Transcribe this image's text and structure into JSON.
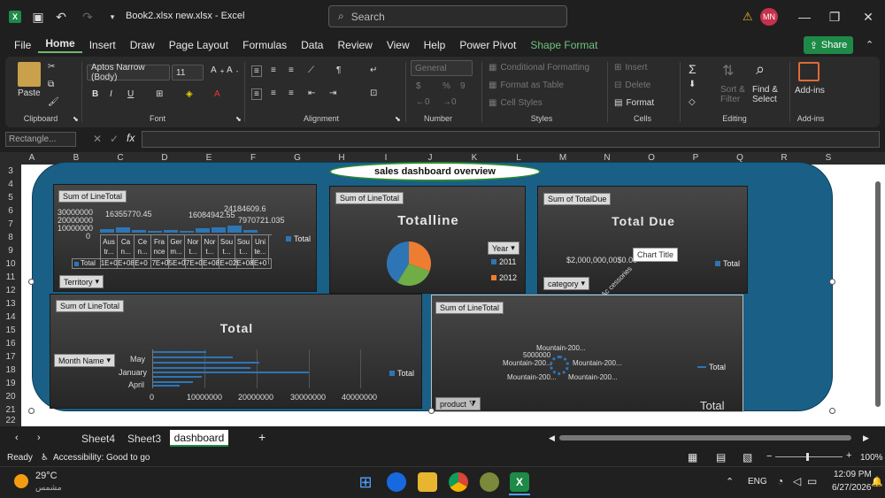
{
  "window": {
    "title": "Book2.xlsx new.xlsx  -  Excel",
    "search_placeholder": "Search",
    "avatar": "MN"
  },
  "menu": [
    "File",
    "Home",
    "Insert",
    "Draw",
    "Page Layout",
    "Formulas",
    "Data",
    "Review",
    "View",
    "Help",
    "Power Pivot",
    "Shape Format"
  ],
  "share_label": "Share",
  "ribbon": {
    "clipboard": {
      "paste": "Paste",
      "label": "Clipboard"
    },
    "font": {
      "name": "Aptos Narrow (Body)",
      "size": "11",
      "label": "Font"
    },
    "alignment": {
      "label": "Alignment"
    },
    "number": {
      "format": "General",
      "label": "Number"
    },
    "styles": {
      "conditional": "Conditional Formatting",
      "table": "Format as Table",
      "cell": "Cell Styles",
      "label": "Styles"
    },
    "cells": {
      "insert": "Insert",
      "delete": "Delete",
      "format": "Format",
      "label": "Cells"
    },
    "editing": {
      "sort": "Sort & Filter",
      "find": "Find & Select",
      "label": "Editing"
    },
    "addins": {
      "btn": "Add-ins",
      "label": "Add-ins"
    }
  },
  "namebox": "Rectangle...",
  "columns": [
    "A",
    "B",
    "C",
    "D",
    "E",
    "F",
    "G",
    "H",
    "I",
    "J",
    "K",
    "L",
    "M",
    "N",
    "O",
    "P",
    "Q",
    "R",
    "S"
  ],
  "rows": [
    "3",
    "4",
    "5",
    "6",
    "7",
    "8",
    "9",
    "10",
    "11",
    "12",
    "13",
    "14",
    "15",
    "16",
    "17",
    "18",
    "19",
    "20",
    "21",
    "22"
  ],
  "dashboard": {
    "banner": "sales dashboard overview",
    "territory": {
      "field": "Sum of LineTotal",
      "filter": "Territory",
      "legend": "Total",
      "y_ticks": [
        "30000000",
        "20000000",
        "10000000",
        "0"
      ],
      "labels": [
        "16355770.45",
        "24184609.6",
        "16084942.55",
        "7970721.035"
      ],
      "categories": [
        "Aus tr...",
        "Ca n...",
        "Ce n...",
        "Fra nce",
        "Ger m...",
        "Nor t...",
        "Nor t...",
        "Sou t...",
        "Sou t...",
        "Uni te..."
      ],
      "table_label": "Total",
      "table_values": [
        "1E+02",
        "E+08",
        "E+0",
        "7E+0",
        "5E+0",
        "7E+02",
        "E+08",
        "E+02",
        "E+08",
        "E+0"
      ]
    },
    "pie": {
      "field": "Sum of LineTotal",
      "title": "Totalline",
      "filter": "Year",
      "legend": [
        "2011",
        "2012"
      ],
      "colors": [
        "#2e75b6",
        "#ed7d31",
        "#70ad47"
      ]
    },
    "due": {
      "field": "Sum of TotalDue",
      "title": "Total Due",
      "filter": "category",
      "value": "$2,000,000,00$0.00",
      "tooltip": "Chart Title",
      "legend": "Total",
      "rotated": "Ac cessories"
    },
    "month": {
      "field": "Sum of LineTotal",
      "title": "Total",
      "filter": "Month Name",
      "legend": "Total",
      "categories": [
        "May",
        "January",
        "April"
      ],
      "x_ticks": [
        "0",
        "10000000",
        "20000000",
        "30000000",
        "40000000"
      ]
    },
    "product": {
      "field": "Sum of LineTotal",
      "filter": "product",
      "legend": "Total",
      "footer": "Total",
      "value": "5000000",
      "labels": [
        "Mountain-200...",
        "Mountain-200...",
        "Mountain-200...",
        "Mountain-200...",
        "Mountain-200..."
      ]
    }
  },
  "tabs": [
    "Sheet4",
    "Sheet3",
    "dashboard"
  ],
  "status": {
    "ready": "Ready",
    "accessibility": "Accessibility: Good to go",
    "zoom": "100%"
  },
  "taskbar": {
    "temp": "29°C",
    "weather": "مشمس",
    "lang": "ENG",
    "time": "12:09 PM",
    "date": "6/27/2026"
  }
}
